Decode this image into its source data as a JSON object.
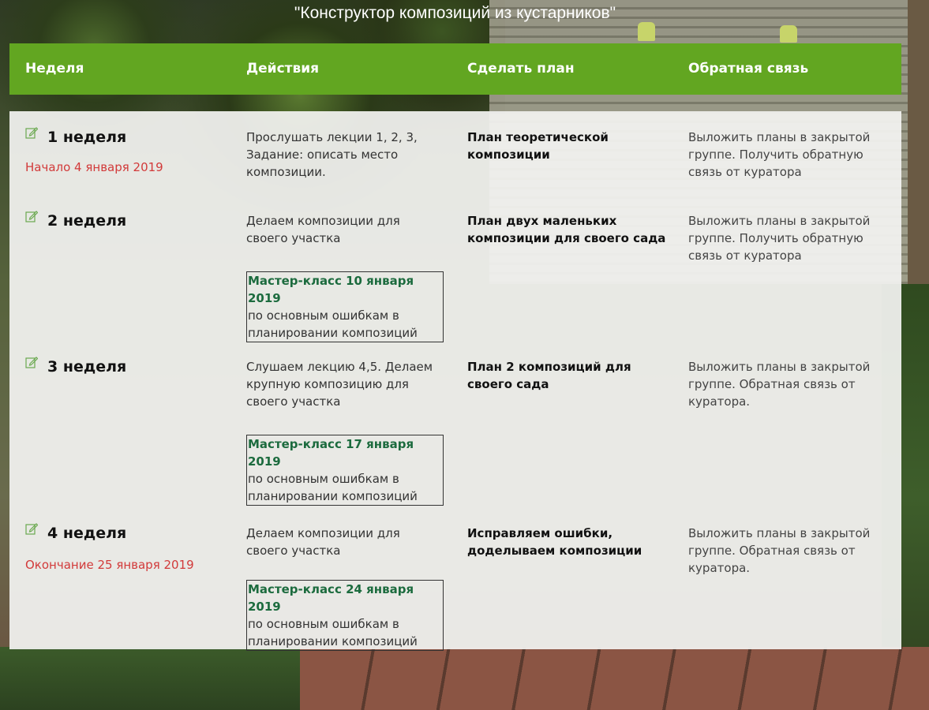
{
  "title": "\"Конструктор композиций из кустарников\"",
  "header": {
    "week": "Неделя",
    "actions": "Действия",
    "plan": "Сделать план",
    "feedback": "Обратная связь"
  },
  "rows": [
    {
      "week": "1 неделя",
      "date": "Начало 4 января 2019",
      "action": "Прослушать лекции 1, 2, 3, Задание: описать место композиции.",
      "plan": "План теоретической композиции",
      "feedback": "Выложить планы в закрытой группе. Получить обратную связь от куратора"
    },
    {
      "week": "2 неделя",
      "action": "Делаем композиции для своего участка",
      "mk_title": "Мастер-класс 10 января 2019",
      "mk_text": "по основным ошибкам в планировании композиций",
      "plan": "План двух маленьких композиции для своего сада",
      "feedback": "Выложить планы в закрытой группе. Получить обратную связь от куратора"
    },
    {
      "week": "3 неделя",
      "action": "Слушаем лекцию 4,5. Делаем крупную композицию для своего участка",
      "mk_title": "Мастер-класс 17 января 2019",
      "mk_text": "по основным ошибкам в планировании композиций",
      "plan": "План 2 композиций для своего сада",
      "feedback": "Выложить планы в закрытой группе. Обратная связь от куратора."
    },
    {
      "week": "4 неделя",
      "date": "Окончание 25 января 2019",
      "action": "Делаем композиции для своего участка",
      "mk_title": "Мастер-класс 24 января 2019",
      "mk_text": "по основным ошибкам в планировании композиций",
      "plan": "Исправляем ошибки, доделываем композиции",
      "feedback": "Выложить планы в закрытой группе. Обратная связь от куратора."
    }
  ],
  "icons": {
    "week_icon": "edit-icon"
  },
  "colors": {
    "header": "#62a621",
    "date": "#d23a3a",
    "mk_title": "#1c6b3e"
  }
}
